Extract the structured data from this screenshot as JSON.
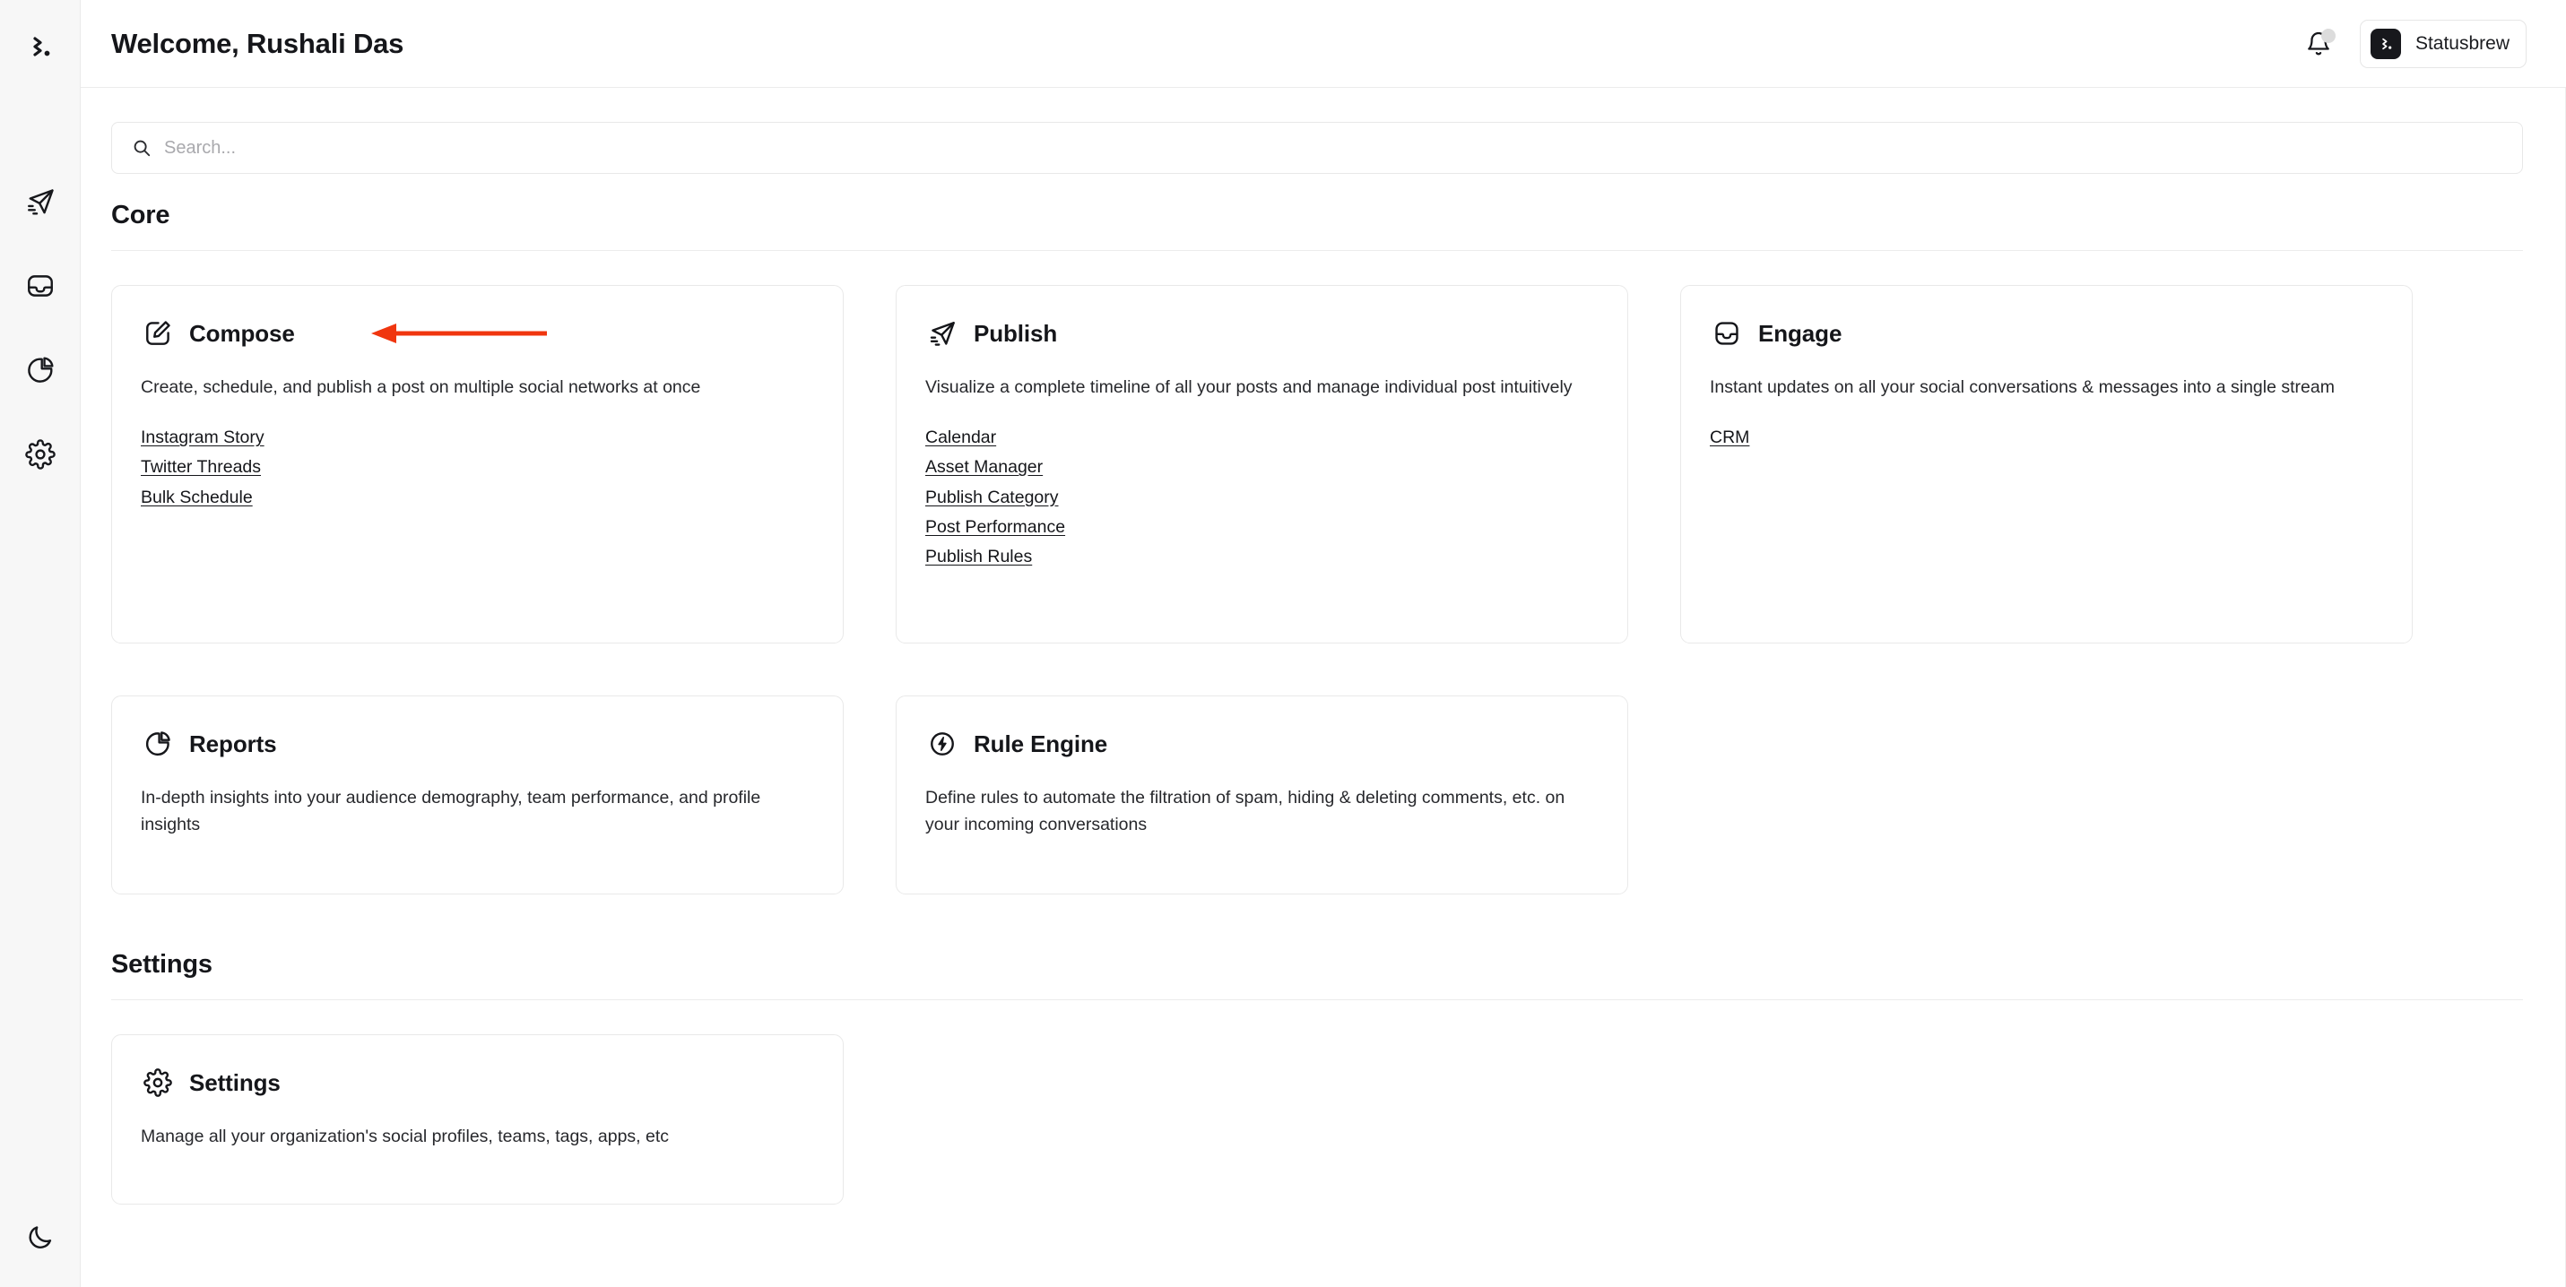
{
  "sidebar": {
    "logo_name": "statusbrew-logo",
    "items": [
      {
        "name": "publish",
        "icon": "paper-plane-icon"
      },
      {
        "name": "engage",
        "icon": "inbox-icon"
      },
      {
        "name": "reports",
        "icon": "pie-chart-icon"
      },
      {
        "name": "settings",
        "icon": "gear-icon"
      }
    ],
    "theme_toggle": {
      "name": "dark-mode-toggle",
      "icon": "moon-icon"
    }
  },
  "header": {
    "title": "Welcome, Rushali Das",
    "notifications_icon": "bell-icon",
    "has_notification_badge": true,
    "org_name": "Statusbrew"
  },
  "search": {
    "placeholder": "Search...",
    "value": "",
    "icon": "search-icon"
  },
  "sections": [
    {
      "id": "core",
      "title": "Core",
      "cards": [
        {
          "title": "Compose",
          "icon": "compose-pencil-icon",
          "description": "Create, schedule, and publish a post on multiple social networks at once",
          "links": [
            "Instagram Story",
            "Twitter Threads",
            "Bulk Schedule"
          ],
          "annotated": true
        },
        {
          "title": "Publish",
          "icon": "paper-plane-icon",
          "description": "Visualize a complete timeline of all your posts and manage individual post intuitively",
          "links": [
            "Calendar",
            "Asset Manager",
            "Publish Category",
            "Post Performance",
            "Publish Rules"
          ],
          "annotated": false
        },
        {
          "title": "Engage",
          "icon": "inbox-icon",
          "description": "Instant updates on all your social conversations & messages into a single stream",
          "links": [
            "CRM"
          ],
          "annotated": false
        },
        {
          "title": "Reports",
          "icon": "pie-chart-icon",
          "description": "In-depth insights into your audience demography, team performance, and profile insights",
          "links": [],
          "annotated": false
        },
        {
          "title": "Rule Engine",
          "icon": "bolt-circle-icon",
          "description": "Define rules to automate the filtration of spam, hiding & deleting comments, etc. on your incoming conversations",
          "links": [],
          "annotated": false
        }
      ]
    },
    {
      "id": "settings",
      "title": "Settings",
      "cards": [
        {
          "title": "Settings",
          "icon": "gear-icon",
          "description": "Manage all your organization's social profiles, teams, tags, apps, etc",
          "links": [],
          "annotated": false
        }
      ]
    }
  ],
  "colors": {
    "annotation_arrow": "#F0360F",
    "text_primary": "#15161A",
    "sidebar_bg": "#F7F7F7",
    "card_border": "#E9E9E9",
    "org_logo_bg": "#17181C"
  }
}
